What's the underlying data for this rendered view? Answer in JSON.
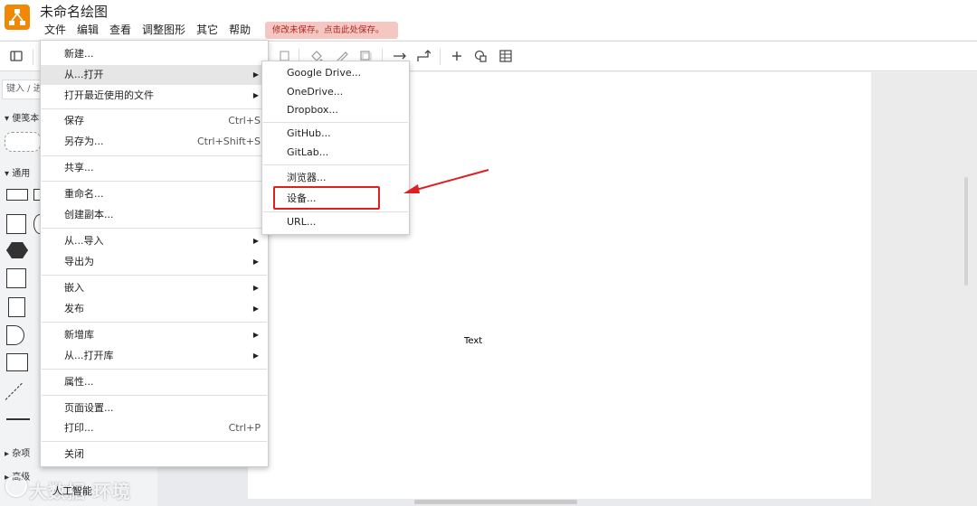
{
  "app": {
    "title": "未命名绘图",
    "logo_color": "#f08705",
    "menubar": [
      "文件",
      "编辑",
      "查看",
      "调整图形",
      "其它",
      "帮助"
    ],
    "save_warning": "修改未保存。点击此处保存。"
  },
  "toolbar": {
    "icons": [
      "sidebar-toggle-icon",
      "copy-style-icon",
      "fill-color-icon",
      "line-color-icon",
      "shadow-icon",
      "connection-straight-icon",
      "waypoint-icon",
      "insert-plus-icon",
      "shapes-icon",
      "table-icon"
    ]
  },
  "sidebar": {
    "search_placeholder": "键入 / 进",
    "sections": [
      "便笺本",
      "通用",
      "杂项",
      "高级"
    ]
  },
  "canvas": {
    "text_label": "Text"
  },
  "file_menu": {
    "items": [
      {
        "label": "新建...",
        "shortcut": "",
        "submenu": false
      },
      {
        "label": "从...打开",
        "shortcut": "",
        "submenu": true
      },
      {
        "label": "打开最近使用的文件",
        "shortcut": "",
        "submenu": true
      },
      {
        "label": "保存",
        "shortcut": "Ctrl+S",
        "submenu": false
      },
      {
        "label": "另存为...",
        "shortcut": "Ctrl+Shift+S",
        "submenu": false
      },
      {
        "label": "共享...",
        "shortcut": "",
        "submenu": false
      },
      {
        "label": "重命名...",
        "shortcut": "",
        "submenu": false
      },
      {
        "label": "创建副本...",
        "shortcut": "",
        "submenu": false
      },
      {
        "label": "从...导入",
        "shortcut": "",
        "submenu": true
      },
      {
        "label": "导出为",
        "shortcut": "",
        "submenu": true
      },
      {
        "label": "嵌入",
        "shortcut": "",
        "submenu": true
      },
      {
        "label": "发布",
        "shortcut": "",
        "submenu": true
      },
      {
        "label": "新增库",
        "shortcut": "",
        "submenu": true
      },
      {
        "label": "从...打开库",
        "shortcut": "",
        "submenu": true
      },
      {
        "label": "属性...",
        "shortcut": "",
        "submenu": false
      },
      {
        "label": "页面设置...",
        "shortcut": "",
        "submenu": false
      },
      {
        "label": "打印...",
        "shortcut": "Ctrl+P",
        "submenu": false
      },
      {
        "label": "关闭",
        "shortcut": "",
        "submenu": false
      }
    ]
  },
  "open_from_submenu": {
    "items": [
      "Google Drive...",
      "OneDrive...",
      "Dropbox...",
      "GitHub...",
      "GitLab...",
      "浏览器...",
      "设备...",
      "URL..."
    ]
  },
  "annotation": {
    "highlight_color": "#e02020",
    "highlighted_item": "设备..."
  },
  "watermark": {
    "text": "大数据 环境",
    "overlay_text": "人工智能"
  }
}
